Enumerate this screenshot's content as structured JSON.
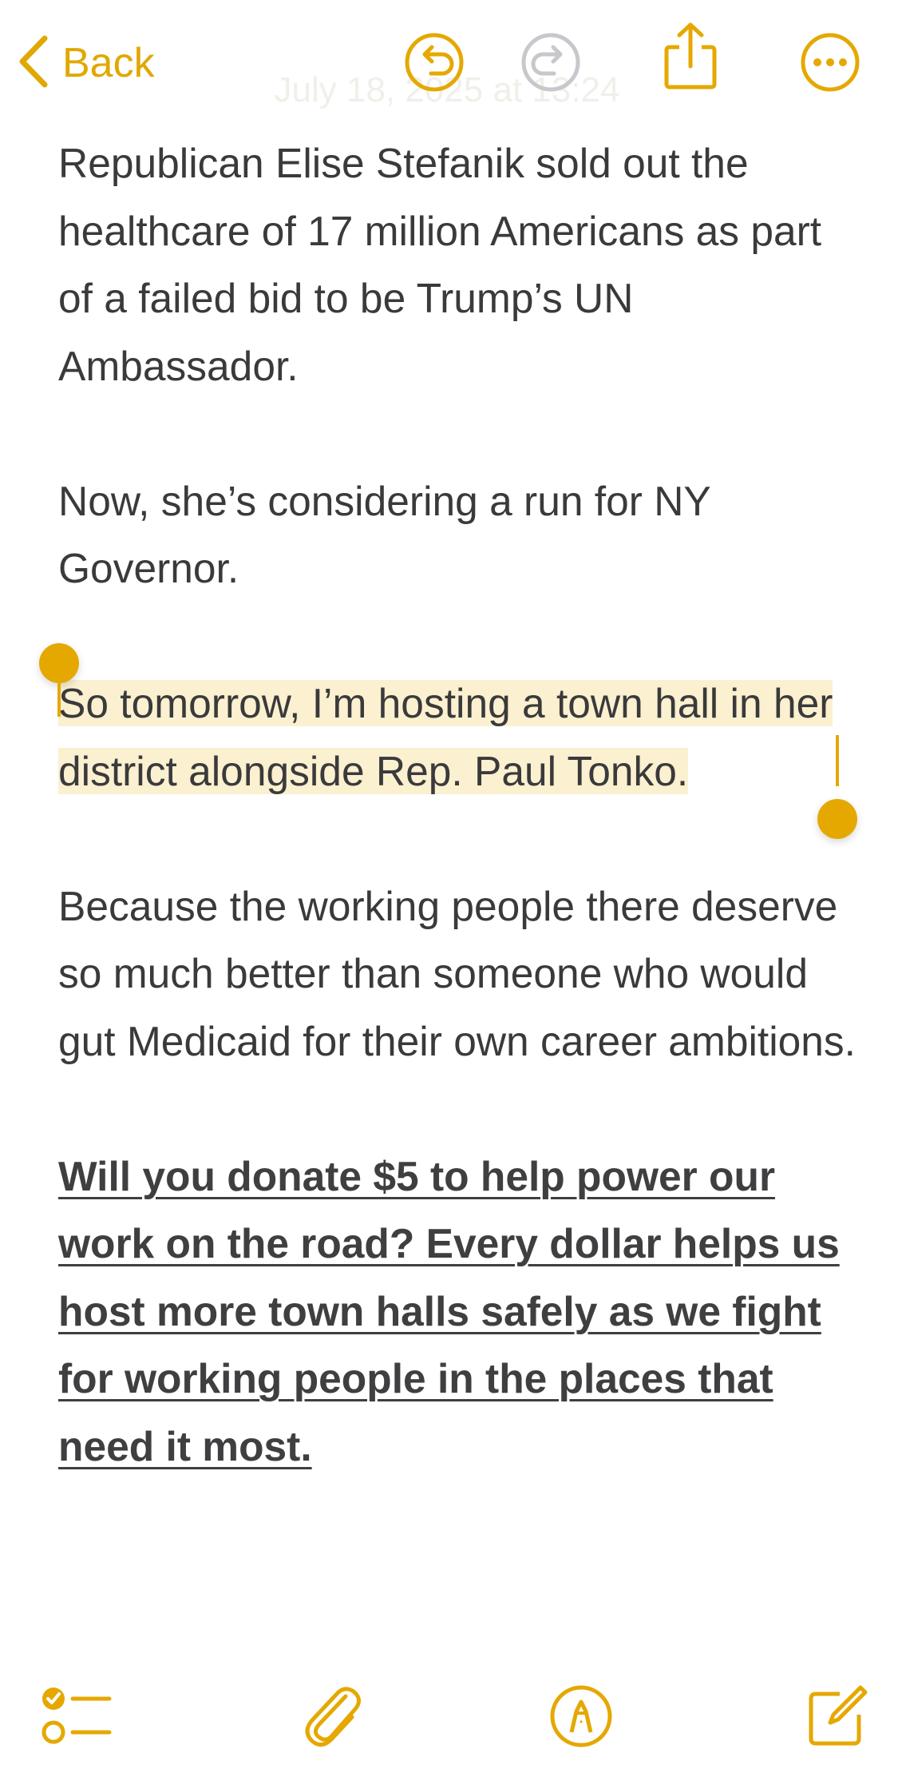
{
  "toolbar": {
    "back_label": "Back",
    "icons": [
      "chevron-left-icon",
      "undo-icon",
      "redo-icon",
      "share-icon",
      "more-icon"
    ],
    "ghost_date": "July 18, 2025 at 13:24"
  },
  "note": {
    "paragraph_1": "Republican Elise Stefanik sold out the healthcare of 17 million Americans as part of a failed bid to be Trump’s UN Ambassador.",
    "paragraph_2": "Now, she’s considering a run for NY Governor.",
    "paragraph_3_selected": "So tomorrow, I’m hosting a town hall in her district alongside Rep. Paul Tonko.",
    "paragraph_4": "Because the working people there deserve so much better than someone who would gut Medicaid for their own career ambitions.",
    "paragraph_5_link": "Will you donate $5 to help power our work on the road? Every dollar helps us host more town halls safely as we fight for working people in the places that need it most."
  },
  "bottom_toolbar": {
    "icons": [
      "checklist-icon",
      "paperclip-icon",
      "markup-pen-icon",
      "compose-icon"
    ]
  },
  "colors": {
    "accent": "#e5a800",
    "selection_highlight": "#fbf0cf",
    "body_text": "#3a3a3c",
    "disabled_icon": "#c7c7cc"
  }
}
